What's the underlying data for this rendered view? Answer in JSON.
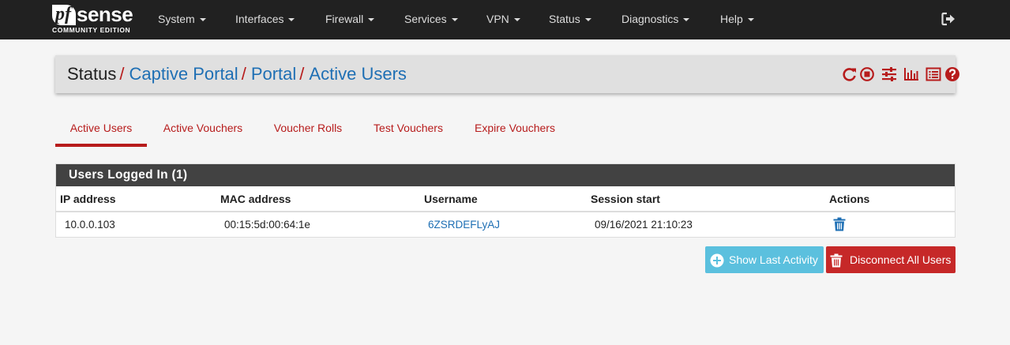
{
  "brand": {
    "logo_pf": "pf",
    "logo_sense": "sense",
    "edition": "COMMUNITY EDITION"
  },
  "nav": {
    "items": [
      "System",
      "Interfaces",
      "Firewall",
      "Services",
      "VPN",
      "Status",
      "Diagnostics",
      "Help"
    ],
    "logout_icon": "logout-icon"
  },
  "breadcrumb": {
    "root": "Status",
    "separator": "/",
    "links": [
      "Captive Portal",
      "Portal",
      "Active Users"
    ],
    "icons": [
      "refresh-icon",
      "stop-circle-icon",
      "sliders-icon",
      "bar-chart-icon",
      "log-list-icon",
      "help-icon"
    ]
  },
  "tabs": [
    {
      "label": "Active Users",
      "active": true
    },
    {
      "label": "Active Vouchers",
      "active": false
    },
    {
      "label": "Voucher Rolls",
      "active": false
    },
    {
      "label": "Test Vouchers",
      "active": false
    },
    {
      "label": "Expire Vouchers",
      "active": false
    }
  ],
  "panel": {
    "title": "Users Logged In (1)",
    "columns": [
      "IP address",
      "MAC address",
      "Username",
      "Session start",
      "Actions"
    ],
    "rows": [
      {
        "ip": "10.0.0.103",
        "mac": "00:15:5d:00:64:1e",
        "username": "6ZSRDEFLyAJ",
        "session_start": "09/16/2021 21:10:23",
        "action_icon": "trash-icon"
      }
    ]
  },
  "buttons": {
    "show_last_activity": "Show Last Activity",
    "disconnect_all": "Disconnect All Users"
  },
  "colors": {
    "navbar": "#212121",
    "accent_red": "#b71c1c",
    "link_blue": "#1e6fb4",
    "info": "#5bc0de",
    "danger": "#c62828"
  }
}
